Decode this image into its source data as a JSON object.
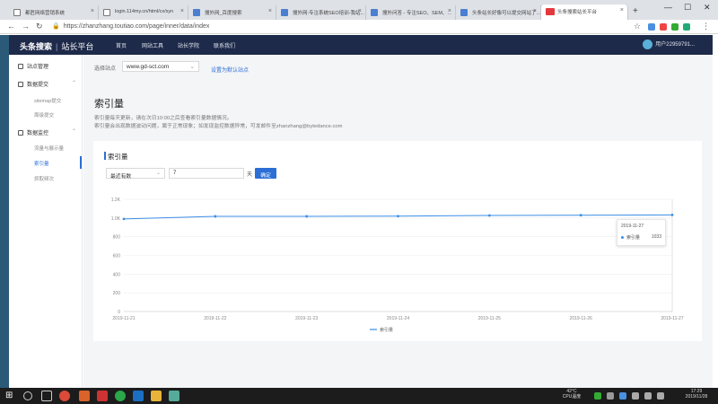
{
  "browser": {
    "tabs": [
      {
        "title": "都匠网络营销系统"
      },
      {
        "title": "login.114my.cn/html/cx/syn"
      },
      {
        "title": "搜外网_百度搜索"
      },
      {
        "title": "搜外网:专注系统SEO培训-我站..."
      },
      {
        "title": "搜外问答 - 专注SEO、SEM、..."
      },
      {
        "title": "头条站长好像可以提交网站了..."
      },
      {
        "title": "头条搜索站长平台"
      }
    ],
    "url": "https://zhanzhang.toutiao.com/page/inner/data/index"
  },
  "app": {
    "logo": "头条搜索",
    "logo_sub": "站长平台",
    "nav": [
      "首页",
      "网站工具",
      "站长学院",
      "联系我们"
    ],
    "user": "用户22959791..."
  },
  "sidebar": {
    "site_manage": "站点管理",
    "data_submit": "数据提交",
    "sitemap": "sitemap提交",
    "periodic": "周级提交",
    "data_monitor": "数据监控",
    "traffic": "流量与展示量",
    "index_count": "索引量",
    "crawl_freq": "抓取频次"
  },
  "main": {
    "site_label": "选择站点",
    "site_value": "www.gd-sct.com",
    "set_default": "设置为默认站点",
    "title": "索引量",
    "desc1": "索引量每天更新，请在次日10:00之后查看索引量数据情况。",
    "desc2": "索引量会出现数据波动问题，属于正常现象；如发现监控数据异常，可发邮件至zhanzhang@bytedance.com"
  },
  "card": {
    "title": "索引量",
    "range_select": "最近有数",
    "days_value": "7",
    "days_unit": "天",
    "confirm": "确定"
  },
  "tooltip": {
    "date": "2019-11-27",
    "series": "索引量",
    "value": "1033"
  },
  "chart_data": {
    "type": "line",
    "x": [
      "2019-11-21",
      "2019-11-22",
      "2019-11-23",
      "2019-11-24",
      "2019-11-25",
      "2019-11-26",
      "2019-11-27"
    ],
    "series": [
      {
        "name": "索引量",
        "values": [
          990,
          1018,
          1018,
          1020,
          1027,
          1030,
          1033
        ]
      }
    ],
    "yticks": [
      "0",
      "200",
      "400",
      "600",
      "800",
      "1.0K",
      "1.2K"
    ],
    "ylim": [
      0,
      1200
    ],
    "legend": "bottom",
    "grid": true,
    "color": "#3a8ee6"
  },
  "taskbar": {
    "temp": "42°C",
    "cpu": "CPU温度",
    "time": "17:29",
    "date": "2019/11/28"
  }
}
